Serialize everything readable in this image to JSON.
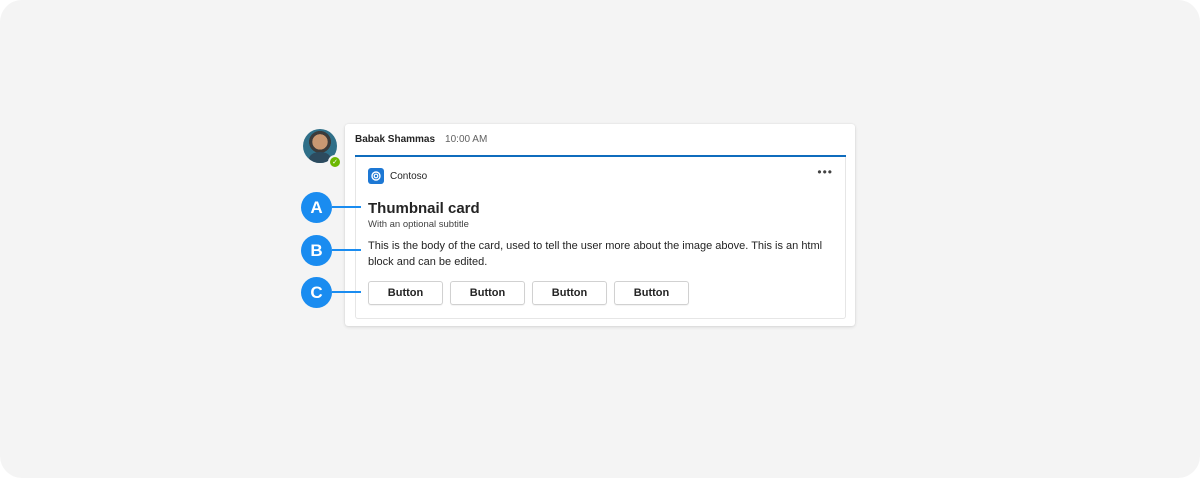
{
  "message": {
    "sender": "Babak Shammas",
    "time": "10:00 AM"
  },
  "card": {
    "app_name": "Contoso",
    "more_label": "•••",
    "title": "Thumbnail card",
    "subtitle": "With an optional subtitle",
    "body": "This is the body of the card, used to tell the user more about the image above. This is an html block and can be edited.",
    "buttons": [
      "Button",
      "Button",
      "Button",
      "Button"
    ]
  },
  "callouts": [
    "A",
    "B",
    "C"
  ],
  "colors": {
    "accent": "#0f6cbd",
    "callout": "#1a8cf0",
    "presence": "#6bb700",
    "background": "#f4f4f4"
  },
  "icons": {
    "presence": "check-icon",
    "app": "contoso-logo-icon",
    "more": "more-options-icon"
  }
}
